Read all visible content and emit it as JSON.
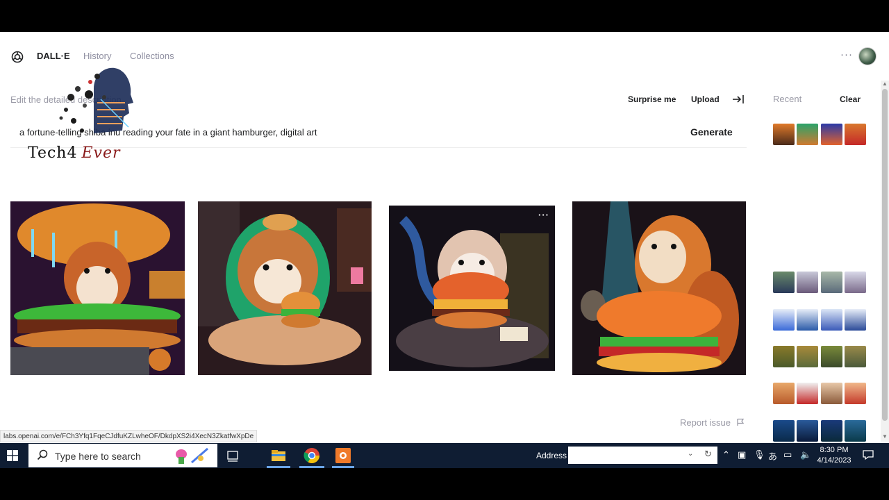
{
  "app": {
    "brand": "DALL·E",
    "nav": [
      "History",
      "Collections"
    ],
    "more_label": "···"
  },
  "editor": {
    "label": "Edit the detailed description",
    "surprise_label": "Surprise me",
    "upload_label": "Upload",
    "prompt_text": "a fortune-telling shiba inu reading your fate in a giant hamburger, digital art",
    "generate_label": "Generate"
  },
  "watermark": {
    "text_main": "Tech4",
    "text_ever": "Ever"
  },
  "sidebar": {
    "recent_label": "Recent",
    "clear_label": "Clear"
  },
  "results": {
    "tile_more_label": "···"
  },
  "footer": {
    "report_label": "Report issue",
    "status_url": "labs.openai.com/e/FCh3Yfq1FqeCJdfuKZLwheOF/DkdpXS2i4XecN3ZkatfwXpDe"
  },
  "taskbar": {
    "search_placeholder": "Type here to search",
    "address_label": "Address",
    "time": "8:30 PM",
    "date": "4/14/2023"
  },
  "colors": {
    "taskbar_bg": "#0f1d33",
    "text_primary": "#202123",
    "text_muted": "#8e8ea0"
  }
}
